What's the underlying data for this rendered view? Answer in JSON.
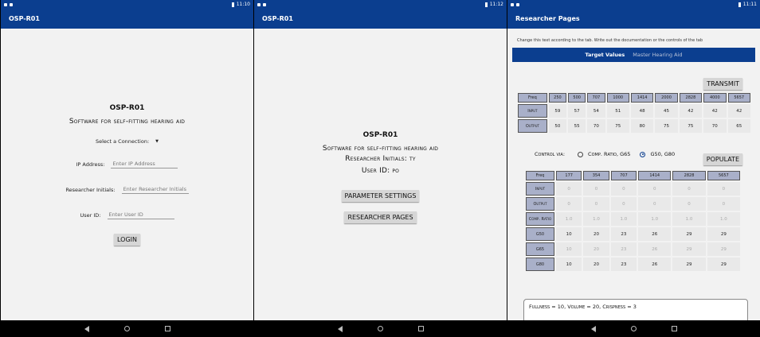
{
  "status": {
    "time_1": "11:10",
    "time_2": "11:12",
    "time_3": "11:11"
  },
  "screen1": {
    "appbar_title": "OSP-R01",
    "heading": "OSP-R01",
    "subtitle": "Software for self-fitting hearing aid",
    "connection_label": "Select a Connection:",
    "ip_label": "IP Address:",
    "ip_placeholder": "Enter IP Address",
    "researcher_label": "Researcher Initials:",
    "researcher_placeholder": "Enter Researcher Initials",
    "user_label": "User ID:",
    "user_placeholder": "Enter User ID",
    "login_button": "LOGIN"
  },
  "screen2": {
    "appbar_title": "OSP-R01",
    "heading": "OSP-R01",
    "subtitle": "Software for self-fitting hearing aid",
    "researcher_initials": "Researcher Initials: ty",
    "user_id": "User ID: po",
    "param_button": "PARAMETER SETTINGS",
    "researcher_button": "RESEARCHER PAGES"
  },
  "screen3": {
    "appbar_title": "Researcher Pages",
    "hint": "Change this text according to the tab. Write out the documentation or the controls of the tab",
    "tabs": [
      "Target Values",
      "Master Hearing Aid"
    ],
    "transmit_button": "TRANSMIT",
    "table1": {
      "freq_label": "Freq",
      "freqs": [
        "250",
        "500",
        "707",
        "1000",
        "1414",
        "2000",
        "2828",
        "4000",
        "5657"
      ],
      "rows": [
        {
          "label": "Input",
          "values": [
            "59",
            "57",
            "54",
            "51",
            "48",
            "45",
            "42",
            "42",
            "42"
          ]
        },
        {
          "label": "Output",
          "values": [
            "50",
            "55",
            "70",
            "75",
            "80",
            "75",
            "75",
            "70",
            "65"
          ]
        }
      ]
    },
    "control_label": "Control via:",
    "radio1": "Comp. Ratio, G65",
    "radio2": "G50, G80",
    "populate_button": "POPULATE",
    "table2": {
      "freq_label": "Freq",
      "freqs": [
        "177",
        "354",
        "707",
        "1414",
        "2828",
        "5657"
      ],
      "rows": [
        {
          "label": "Input",
          "dim": true,
          "values": [
            "0",
            "0",
            "0",
            "0",
            "0",
            "0"
          ]
        },
        {
          "label": "Output",
          "dim": true,
          "values": [
            "0",
            "0",
            "0",
            "0",
            "0",
            "0"
          ]
        },
        {
          "label": "Comp. Ratio",
          "dim": true,
          "values": [
            "1.0",
            "1.0",
            "1.0",
            "1.0",
            "1.0",
            "1.0"
          ]
        },
        {
          "label": "G50",
          "dim": false,
          "values": [
            "10",
            "20",
            "23",
            "26",
            "29",
            "29"
          ]
        },
        {
          "label": "G65",
          "dim": true,
          "values": [
            "10",
            "20",
            "23",
            "26",
            "29",
            "29"
          ]
        },
        {
          "label": "G80",
          "dim": false,
          "values": [
            "10",
            "20",
            "23",
            "26",
            "29",
            "29"
          ]
        }
      ]
    },
    "summary_text": "Fullness = 10, Volume = 20, Crispness = 3"
  }
}
